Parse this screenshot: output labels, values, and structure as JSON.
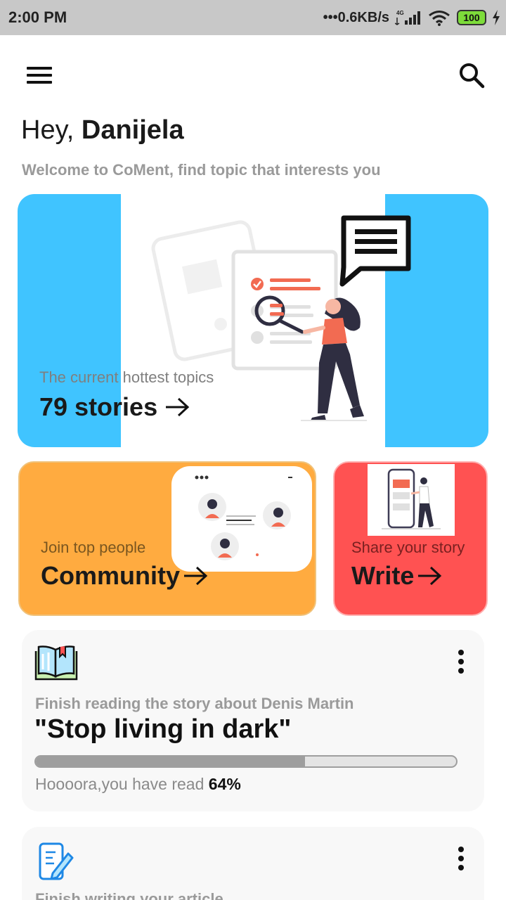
{
  "status_bar": {
    "time": "2:00 PM",
    "speed": "•••0.6KB/s",
    "network": "4G",
    "battery": "100"
  },
  "header": {
    "menu_icon": "hamburger-menu-icon",
    "search_icon": "search-icon"
  },
  "greeting": {
    "hey": "Hey,",
    "name": "Danijela",
    "welcome": "Welcome to CoMent, find topic that interests you"
  },
  "hot_topics": {
    "subtitle": "The current hottest topics",
    "title": "79 stories",
    "arrow": "→",
    "color": "#40c4ff"
  },
  "community": {
    "subtitle": "Join top people",
    "title": "Community",
    "arrow": "→",
    "color": "#ffab40"
  },
  "write": {
    "subtitle": "Share your story",
    "title": "Write",
    "arrow": "→",
    "color": "#ff5252"
  },
  "reading": {
    "icon": "book-icon",
    "subtitle": "Finish reading the story about Denis Martin",
    "title": "\"Stop living in dark\"",
    "status_prefix": "Hoooora,you have read ",
    "percent_label": "64%",
    "progress": 0.64
  },
  "article": {
    "icon": "pencil-note-icon",
    "subtitle": "Finish writing your article"
  }
}
